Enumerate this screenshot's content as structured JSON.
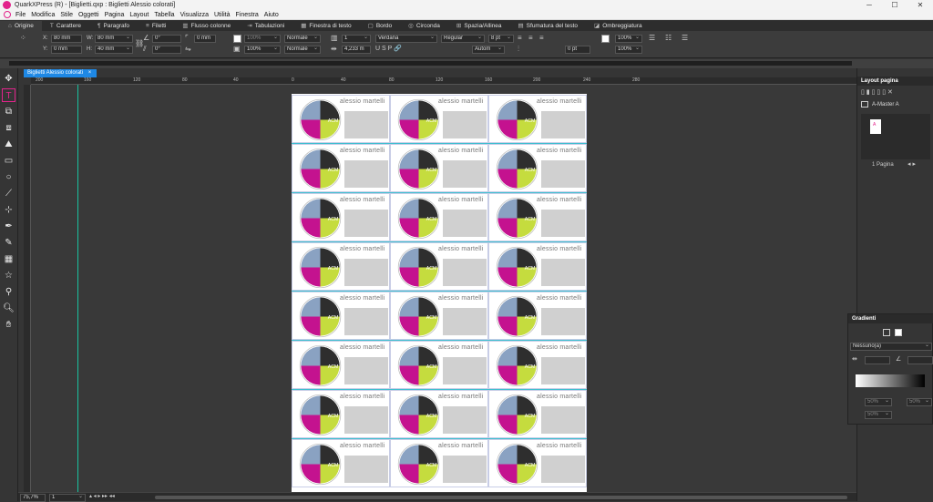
{
  "window": {
    "title": "QuarkXPress (R) - [Biglietti.qxp : Biglietti Alessio colorati]",
    "controls": [
      "─",
      "☐",
      "✕"
    ]
  },
  "menu": [
    "File",
    "Modifica",
    "Stile",
    "Oggetti",
    "Pagina",
    "Layout",
    "Tabella",
    "Visualizza",
    "Utilità",
    "Finestra",
    "Aiuto"
  ],
  "tabs": [
    "Origine",
    "Carattere",
    "Paragrafo",
    "Filetti",
    "Flusso colonne",
    "Tabulazioni",
    "Finestra di testo",
    "Bordo",
    "Circonda",
    "Spazia/Allinea",
    "Sfumatura del testo",
    "Ombreggiatura"
  ],
  "measurements": {
    "x_label": "X:",
    "x_value": "80 mm",
    "y_label": "Y:",
    "y_value": "0 mm",
    "w_label": "W:",
    "w_value": "80 mm",
    "h_label": "H:",
    "h_value": "40 mm",
    "angle1": "0°",
    "angle2": "0°",
    "corner": "0 mm",
    "opacity1": "100%",
    "opacity2": "100%",
    "blend1": "Normale",
    "blend2": "Normale",
    "columns": "1",
    "gutter": "4,233 m",
    "font": "Verdana",
    "style": "Regular",
    "size": "8 pt",
    "leading": "Autom",
    "tracking": "0 pt",
    "color_opacity1": "100%",
    "color_opacity2": "100%"
  },
  "document": {
    "tab_label": "Biglietti Alessio colorati",
    "ruler_numbers": [
      "200",
      "160",
      "120",
      "80",
      "40",
      "0",
      "40",
      "80",
      "120",
      "160",
      "200",
      "240",
      "280"
    ],
    "card_name": "alessio martelli",
    "logo_text": "ACM"
  },
  "layout_panel": {
    "title": "Layout pagina",
    "master": "A-Master A",
    "page_letter": "A",
    "page_count": "1 Pagina"
  },
  "gradient_panel": {
    "title": "Gradienti",
    "type": "Nessuno(a)",
    "pct1": "50%",
    "pct2": "50%",
    "pct3": "50%"
  },
  "status": {
    "zoom": "75,7%",
    "page": "1"
  },
  "colors": {
    "accent": "#e2238b",
    "logo_magenta": "#c4128f",
    "logo_lime": "#c5dc3e",
    "logo_slate": "#8aa2c2",
    "logo_dark": "#2e2e2e",
    "doc_tab": "#1e88e5"
  }
}
